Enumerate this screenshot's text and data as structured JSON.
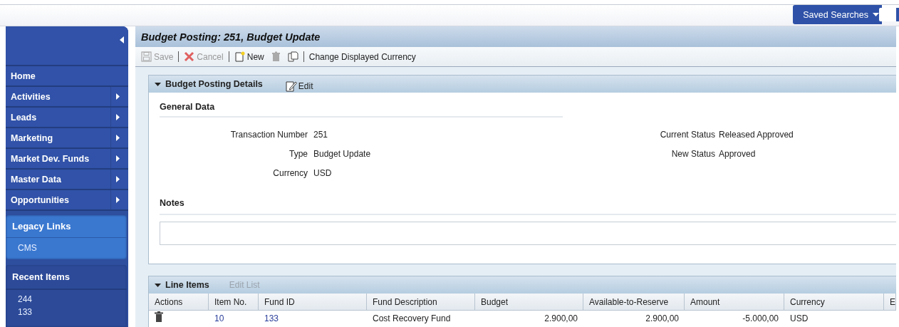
{
  "header": {
    "saved_searches": "Saved Searches"
  },
  "sidebar": {
    "nav_items": [
      {
        "label": "Home",
        "has_submenu": false
      },
      {
        "label": "Activities",
        "has_submenu": true
      },
      {
        "label": "Leads",
        "has_submenu": true
      },
      {
        "label": "Marketing",
        "has_submenu": true
      },
      {
        "label": "Market Dev. Funds",
        "has_submenu": true
      },
      {
        "label": "Master Data",
        "has_submenu": true
      },
      {
        "label": "Opportunities",
        "has_submenu": true
      }
    ],
    "legacy_links": {
      "title": "Legacy Links",
      "items": [
        "CMS"
      ]
    },
    "recent_items": {
      "title": "Recent Items",
      "items": [
        "244",
        "133"
      ]
    }
  },
  "page_title": "Budget Posting: 251, Budget Update",
  "toolbar": [
    {
      "kind": "save",
      "label": "Save",
      "disabled": true
    },
    {
      "kind": "cancel",
      "label": "Cancel",
      "disabled": true
    },
    {
      "kind": "new",
      "label": "New",
      "disabled": false
    },
    {
      "kind": "delete",
      "disabled": true
    },
    {
      "kind": "copy",
      "disabled": false
    },
    {
      "kind": "text",
      "label": "Change Displayed Currency",
      "disabled": false
    }
  ],
  "details": {
    "title": "Budget Posting Details",
    "expanded": true,
    "edit": "Edit",
    "section": "General Data",
    "left_fields": [
      {
        "label": "Transaction Number",
        "value": "251"
      },
      {
        "label": "Type",
        "value": "Budget Update"
      },
      {
        "label": "Currency",
        "value": "USD"
      }
    ],
    "right_fields": [
      {
        "label": "Current Status",
        "value": "Released Approved"
      },
      {
        "label": "New Status",
        "value": "Approved"
      }
    ],
    "notes_label": "Notes"
  },
  "line_items": {
    "title": "Line Items",
    "expanded": true,
    "edit_list": "Edit List",
    "edit_list_disabled": true,
    "columns": [
      "Actions",
      "Item No.",
      "Fund ID",
      "Fund Description",
      "Budget",
      "Available-to-Reserve",
      "Amount",
      "Currency",
      "E"
    ],
    "rows": [
      {
        "item_no": "10",
        "fund_id": "133",
        "fund_description": "Cost Recovery Fund",
        "budget": "2.900,00",
        "available_to_reserve": "2.900,00",
        "amount": "-5.000,00",
        "currency": "USD"
      }
    ]
  }
}
